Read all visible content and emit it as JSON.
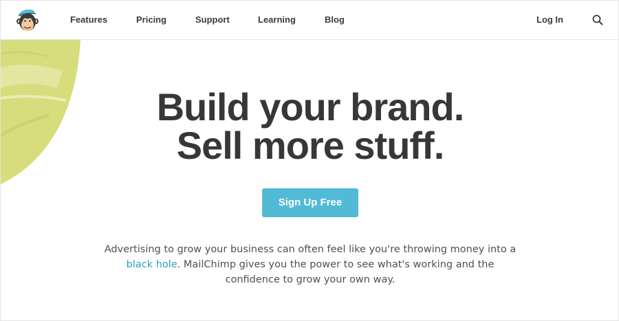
{
  "header": {
    "logo_icon": "freddie-monkey-logo",
    "nav": [
      {
        "label": "Features"
      },
      {
        "label": "Pricing"
      },
      {
        "label": "Support"
      },
      {
        "label": "Learning"
      },
      {
        "label": "Blog"
      }
    ],
    "login_label": "Log In",
    "search_icon": "search-icon"
  },
  "hero": {
    "title_line1": "Build your brand.",
    "title_line2": "Sell more stuff.",
    "cta_label": "Sign Up Free",
    "copy_part1": "Advertising to grow your business can often feel like you're throwing money into a ",
    "copy_link": "black hole",
    "copy_part2": ". MailChimp gives you the power to see what's working and the confidence to grow your own way."
  },
  "colors": {
    "accent": "#52bad5",
    "link": "#2a9fbf",
    "heading": "#373737",
    "blob": "#d7dd7c"
  }
}
